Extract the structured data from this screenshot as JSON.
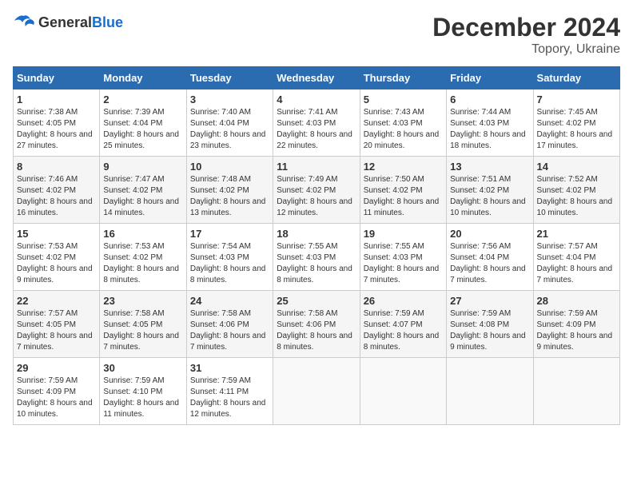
{
  "header": {
    "logo_general": "General",
    "logo_blue": "Blue",
    "month_title": "December 2024",
    "location": "Topory, Ukraine"
  },
  "days_of_week": [
    "Sunday",
    "Monday",
    "Tuesday",
    "Wednesday",
    "Thursday",
    "Friday",
    "Saturday"
  ],
  "weeks": [
    [
      {
        "day": "1",
        "info": "Sunrise: 7:38 AM\nSunset: 4:05 PM\nDaylight: 8 hours and 27 minutes."
      },
      {
        "day": "2",
        "info": "Sunrise: 7:39 AM\nSunset: 4:04 PM\nDaylight: 8 hours and 25 minutes."
      },
      {
        "day": "3",
        "info": "Sunrise: 7:40 AM\nSunset: 4:04 PM\nDaylight: 8 hours and 23 minutes."
      },
      {
        "day": "4",
        "info": "Sunrise: 7:41 AM\nSunset: 4:03 PM\nDaylight: 8 hours and 22 minutes."
      },
      {
        "day": "5",
        "info": "Sunrise: 7:43 AM\nSunset: 4:03 PM\nDaylight: 8 hours and 20 minutes."
      },
      {
        "day": "6",
        "info": "Sunrise: 7:44 AM\nSunset: 4:03 PM\nDaylight: 8 hours and 18 minutes."
      },
      {
        "day": "7",
        "info": "Sunrise: 7:45 AM\nSunset: 4:02 PM\nDaylight: 8 hours and 17 minutes."
      }
    ],
    [
      {
        "day": "8",
        "info": "Sunrise: 7:46 AM\nSunset: 4:02 PM\nDaylight: 8 hours and 16 minutes."
      },
      {
        "day": "9",
        "info": "Sunrise: 7:47 AM\nSunset: 4:02 PM\nDaylight: 8 hours and 14 minutes."
      },
      {
        "day": "10",
        "info": "Sunrise: 7:48 AM\nSunset: 4:02 PM\nDaylight: 8 hours and 13 minutes."
      },
      {
        "day": "11",
        "info": "Sunrise: 7:49 AM\nSunset: 4:02 PM\nDaylight: 8 hours and 12 minutes."
      },
      {
        "day": "12",
        "info": "Sunrise: 7:50 AM\nSunset: 4:02 PM\nDaylight: 8 hours and 11 minutes."
      },
      {
        "day": "13",
        "info": "Sunrise: 7:51 AM\nSunset: 4:02 PM\nDaylight: 8 hours and 10 minutes."
      },
      {
        "day": "14",
        "info": "Sunrise: 7:52 AM\nSunset: 4:02 PM\nDaylight: 8 hours and 10 minutes."
      }
    ],
    [
      {
        "day": "15",
        "info": "Sunrise: 7:53 AM\nSunset: 4:02 PM\nDaylight: 8 hours and 9 minutes."
      },
      {
        "day": "16",
        "info": "Sunrise: 7:53 AM\nSunset: 4:02 PM\nDaylight: 8 hours and 8 minutes."
      },
      {
        "day": "17",
        "info": "Sunrise: 7:54 AM\nSunset: 4:03 PM\nDaylight: 8 hours and 8 minutes."
      },
      {
        "day": "18",
        "info": "Sunrise: 7:55 AM\nSunset: 4:03 PM\nDaylight: 8 hours and 8 minutes."
      },
      {
        "day": "19",
        "info": "Sunrise: 7:55 AM\nSunset: 4:03 PM\nDaylight: 8 hours and 7 minutes."
      },
      {
        "day": "20",
        "info": "Sunrise: 7:56 AM\nSunset: 4:04 PM\nDaylight: 8 hours and 7 minutes."
      },
      {
        "day": "21",
        "info": "Sunrise: 7:57 AM\nSunset: 4:04 PM\nDaylight: 8 hours and 7 minutes."
      }
    ],
    [
      {
        "day": "22",
        "info": "Sunrise: 7:57 AM\nSunset: 4:05 PM\nDaylight: 8 hours and 7 minutes."
      },
      {
        "day": "23",
        "info": "Sunrise: 7:58 AM\nSunset: 4:05 PM\nDaylight: 8 hours and 7 minutes."
      },
      {
        "day": "24",
        "info": "Sunrise: 7:58 AM\nSunset: 4:06 PM\nDaylight: 8 hours and 7 minutes."
      },
      {
        "day": "25",
        "info": "Sunrise: 7:58 AM\nSunset: 4:06 PM\nDaylight: 8 hours and 8 minutes."
      },
      {
        "day": "26",
        "info": "Sunrise: 7:59 AM\nSunset: 4:07 PM\nDaylight: 8 hours and 8 minutes."
      },
      {
        "day": "27",
        "info": "Sunrise: 7:59 AM\nSunset: 4:08 PM\nDaylight: 8 hours and 9 minutes."
      },
      {
        "day": "28",
        "info": "Sunrise: 7:59 AM\nSunset: 4:09 PM\nDaylight: 8 hours and 9 minutes."
      }
    ],
    [
      {
        "day": "29",
        "info": "Sunrise: 7:59 AM\nSunset: 4:09 PM\nDaylight: 8 hours and 10 minutes."
      },
      {
        "day": "30",
        "info": "Sunrise: 7:59 AM\nSunset: 4:10 PM\nDaylight: 8 hours and 11 minutes."
      },
      {
        "day": "31",
        "info": "Sunrise: 7:59 AM\nSunset: 4:11 PM\nDaylight: 8 hours and 12 minutes."
      },
      null,
      null,
      null,
      null
    ]
  ]
}
